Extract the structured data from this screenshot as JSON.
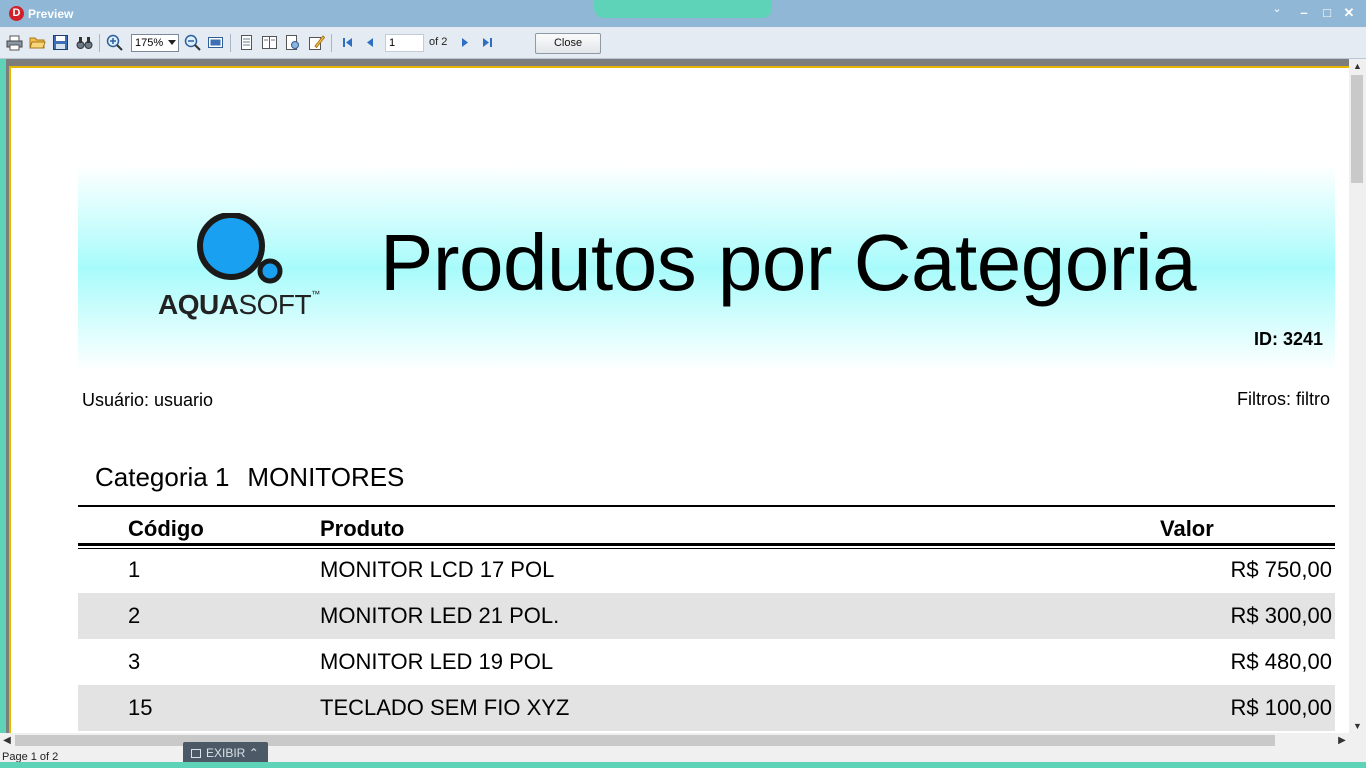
{
  "window": {
    "title": "Preview",
    "app_icon_letter": "D"
  },
  "toolbar": {
    "zoom": "175%",
    "page_input": "1",
    "page_of": "of 2",
    "close_label": "Close"
  },
  "report": {
    "logo_text_bold": "AQUA",
    "logo_text_light": "SOFT",
    "logo_tm": "™",
    "title": "Produtos por Categoria",
    "id_label": "ID: 3241",
    "user_label": "Usuário: usuario",
    "filter_label": "Filtros: filtro",
    "category_label": "Categoria 1",
    "category_name": "MONITORES",
    "columns": {
      "code": "Código",
      "product": "Produto",
      "value": "Valor"
    },
    "rows": [
      {
        "code": "1",
        "product": "MONITOR LCD 17 POL",
        "value": "R$ 750,00"
      },
      {
        "code": "2",
        "product": "MONITOR LED 21 POL.",
        "value": "R$ 300,00"
      },
      {
        "code": "3",
        "product": "MONITOR LED 19 POL",
        "value": "R$ 480,00"
      },
      {
        "code": "15",
        "product": "TECLADO SEM FIO XYZ",
        "value": "R$ 100,00"
      }
    ]
  },
  "status": {
    "page_text": "Page 1 of 2",
    "exibir_label": "EXIBIR"
  },
  "colors": {
    "titlebar": "#90b8d6",
    "accent": "#5fd3b8",
    "header_band": "#a8fbfb",
    "logo_blue": "#1aa0f0",
    "row_alt": "#e3e3e3"
  }
}
